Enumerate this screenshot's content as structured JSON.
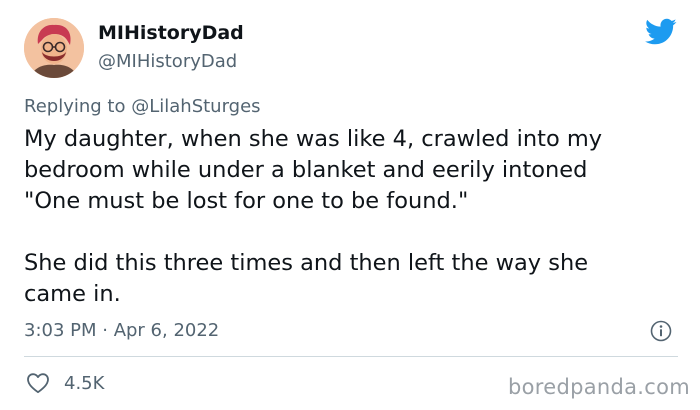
{
  "author": {
    "display_name": "MIHistoryDad",
    "handle": "@MIHistoryDad"
  },
  "reply": {
    "prefix": "Replying to",
    "mention": "@LilahSturges"
  },
  "tweet": {
    "text": "My daughter, when she was like 4, crawled into my\nbedroom while under a blanket and eerily intoned\n\"One must be lost for one to be found.\"\n\nShe did this three times and then left the way she\ncame in.",
    "timestamp": "3:03 PM · Apr 6, 2022"
  },
  "stats": {
    "likes": "4.5K"
  },
  "watermark": "boredpanda.com",
  "icons": {
    "brand": "twitter-bird-icon",
    "info": "info-icon",
    "like": "heart-icon"
  },
  "colors": {
    "twitter_blue": "#1d9bf0",
    "secondary_text": "#536471",
    "primary_text": "#0f1419"
  }
}
